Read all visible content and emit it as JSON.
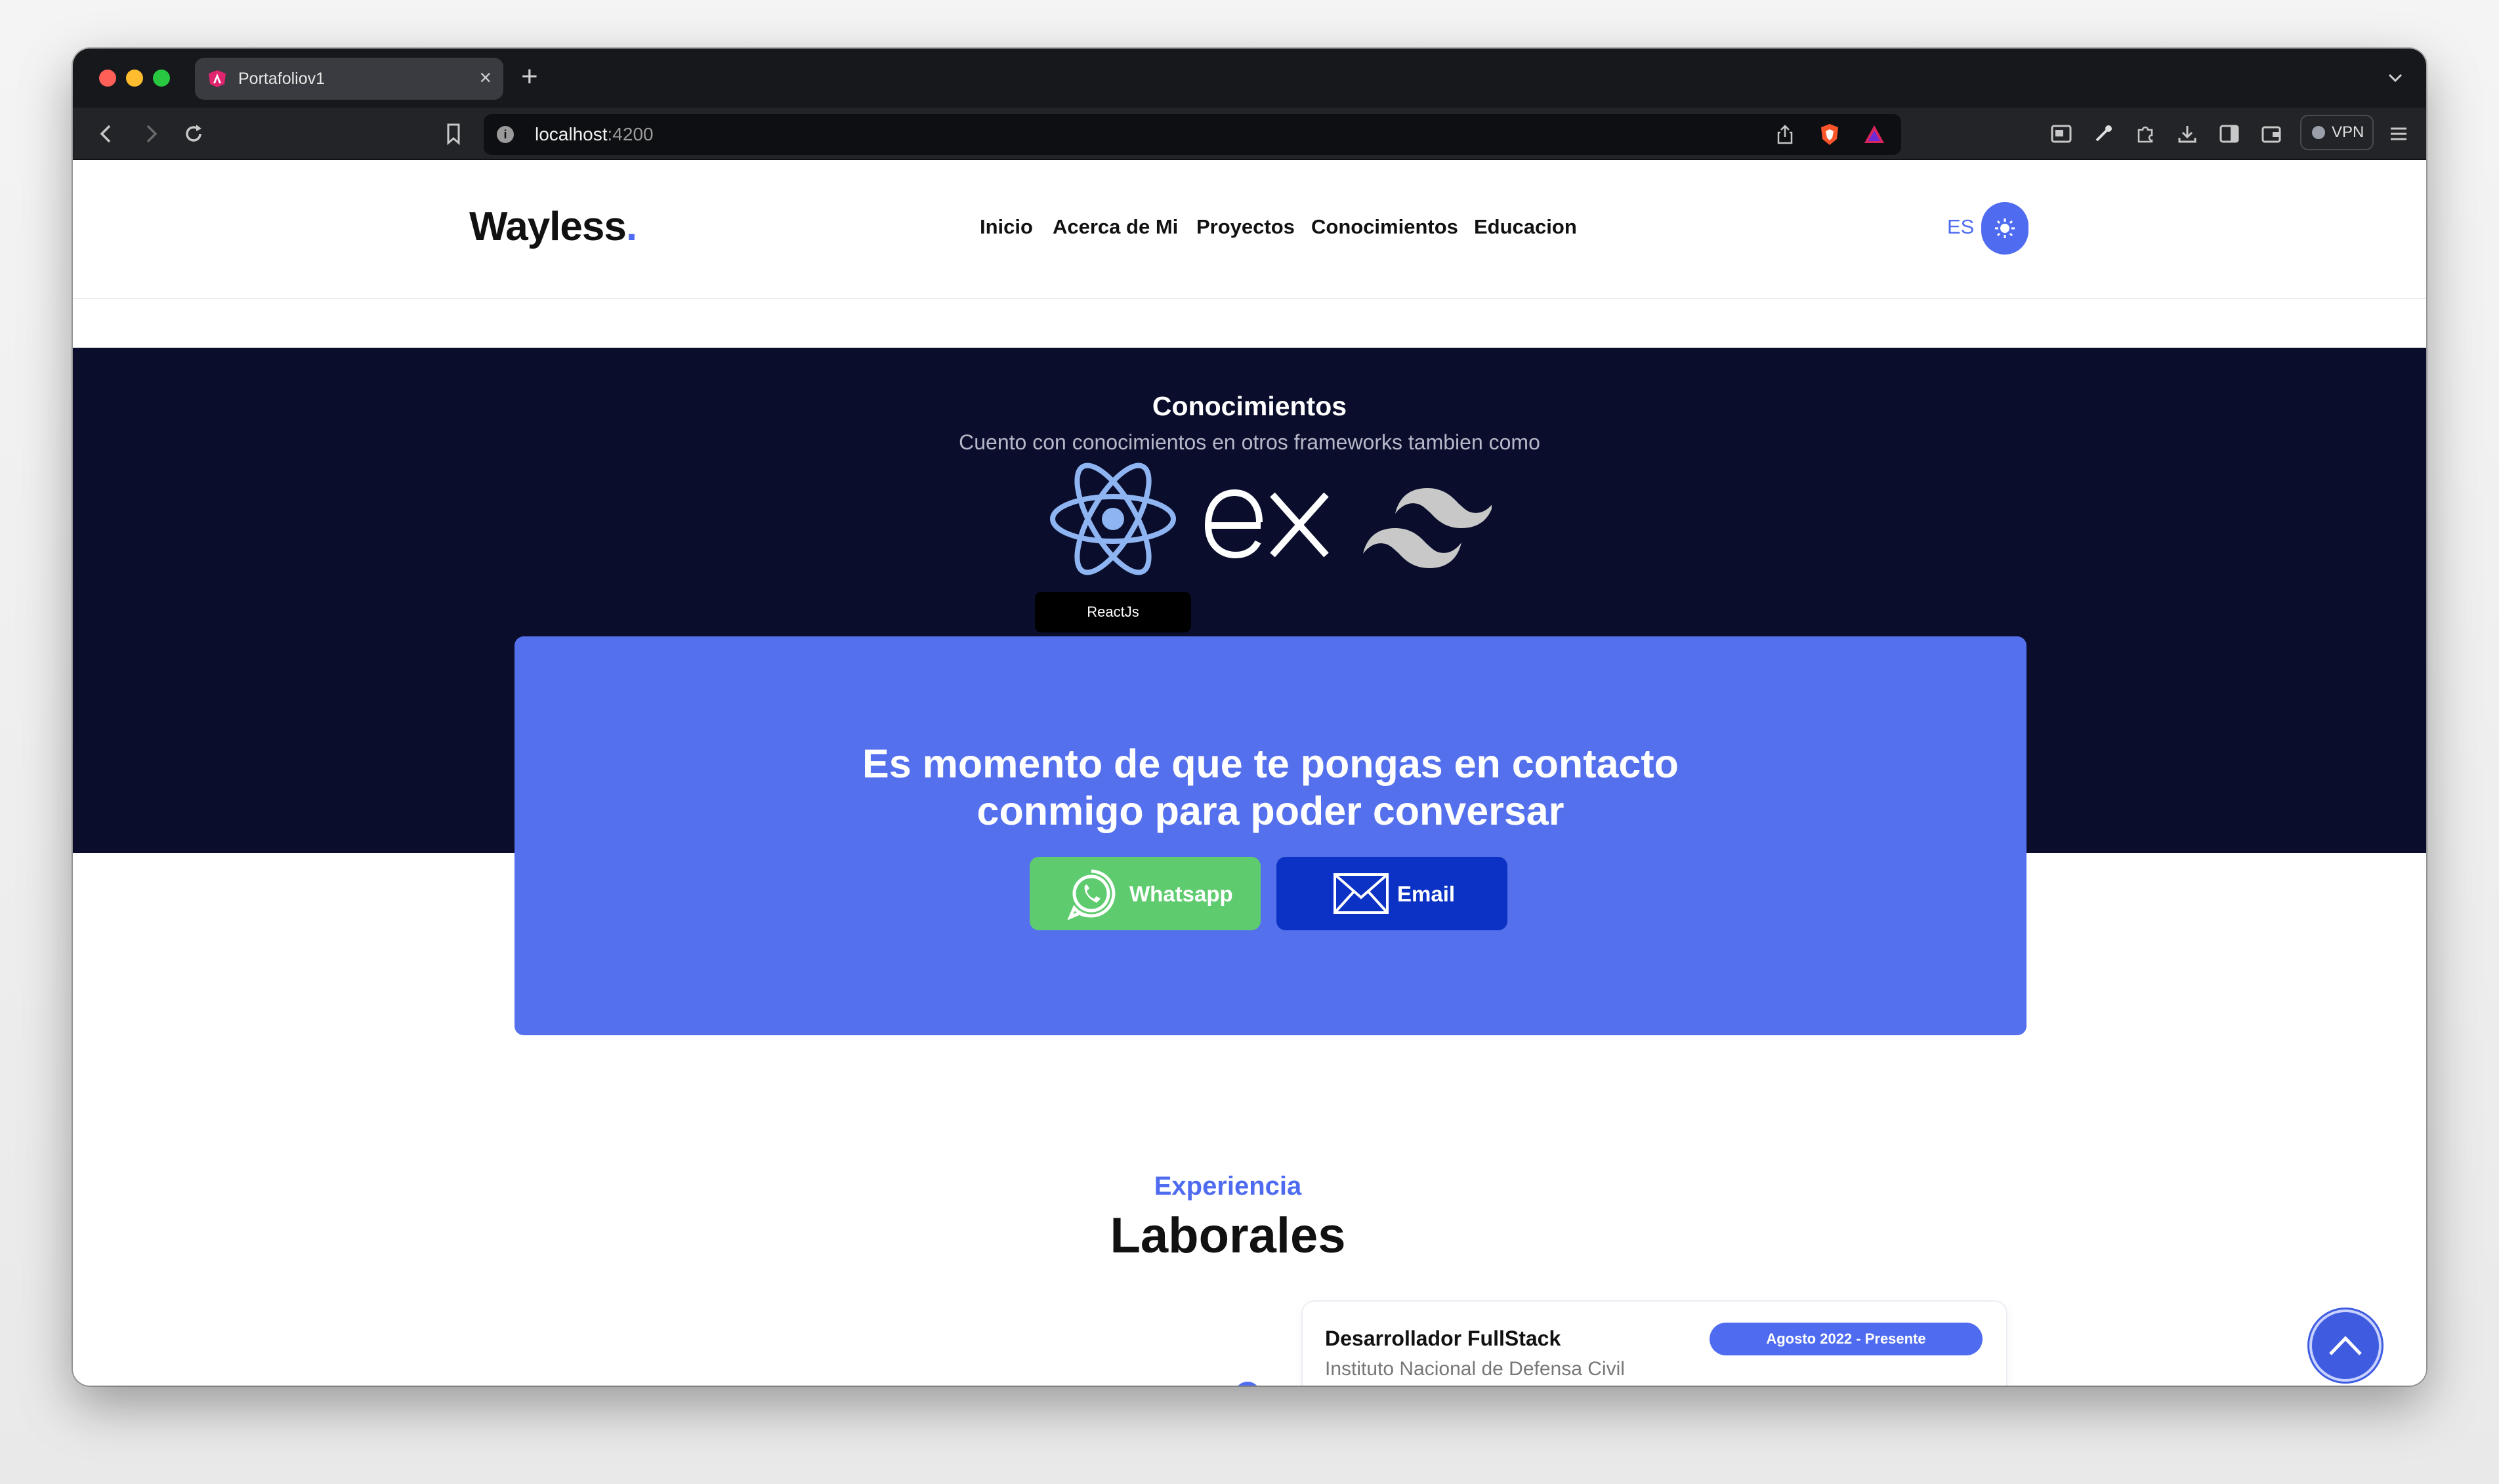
{
  "browser": {
    "tab_title": "Portafoliov1",
    "tab_close": "×",
    "new_tab": "+",
    "url_host": "localhost",
    "url_port": ":4200",
    "info_glyph": "i",
    "vpn_label": "VPN"
  },
  "header": {
    "logo": "Wayless",
    "logo_dot": ".",
    "nav": [
      "Inicio",
      "Acerca de Mi",
      "Proyectos",
      "Conocimientos",
      "Educacion"
    ],
    "lang": "ES"
  },
  "knowledge": {
    "title": "Conocimientos",
    "subtitle": "Cuento con conocimientos en otros frameworks tambien como",
    "tooltip": "ReactJs",
    "tech_icons": [
      "react-icon",
      "express-icon",
      "tailwind-icon"
    ]
  },
  "contact": {
    "heading_line1": "Es momento de que te pongas en contacto",
    "heading_line2": "conmigo para poder conversar",
    "whatsapp_label": "Whatsapp",
    "email_label": "Email"
  },
  "experience": {
    "kicker": "Experiencia",
    "title": "Laborales",
    "items": [
      {
        "role": "Desarrollador FullStack",
        "org": "Instituto Nacional de Defensa Civil",
        "date": "Agosto 2022 - Presente"
      }
    ]
  },
  "colors": {
    "accent": "#4f6cf0",
    "dark_band": "#0a0e2c",
    "contact_bg": "#5470ed",
    "whatsapp": "#5fcb6f",
    "email": "#0b32c4"
  }
}
